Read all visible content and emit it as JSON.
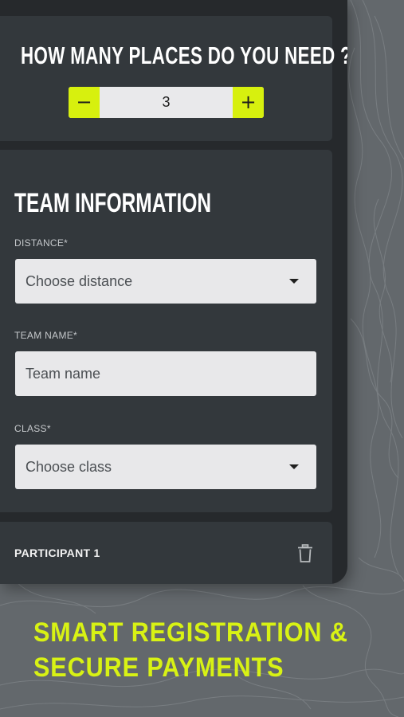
{
  "places": {
    "title": "HOW MANY PLACES DO YOU NEED ?",
    "minus_label": "−",
    "value": "3",
    "plus_label": "+"
  },
  "team": {
    "title": "TEAM INFORMATION",
    "distance_label": "DISTANCE*",
    "distance_placeholder": "Choose distance",
    "team_name_label": "TEAM NAME*",
    "team_name_placeholder": "Team name",
    "class_label": "CLASS*",
    "class_placeholder": "Choose class"
  },
  "participant": {
    "label": "PARTICIPANT 1",
    "delete_icon": "trash-icon"
  },
  "promo": {
    "line1": "SMART REGISTRATION &",
    "line2": "SECURE PAYMENTS"
  },
  "colors": {
    "accent": "#d7f00e",
    "card": "#33383c",
    "background": "#26292c"
  }
}
